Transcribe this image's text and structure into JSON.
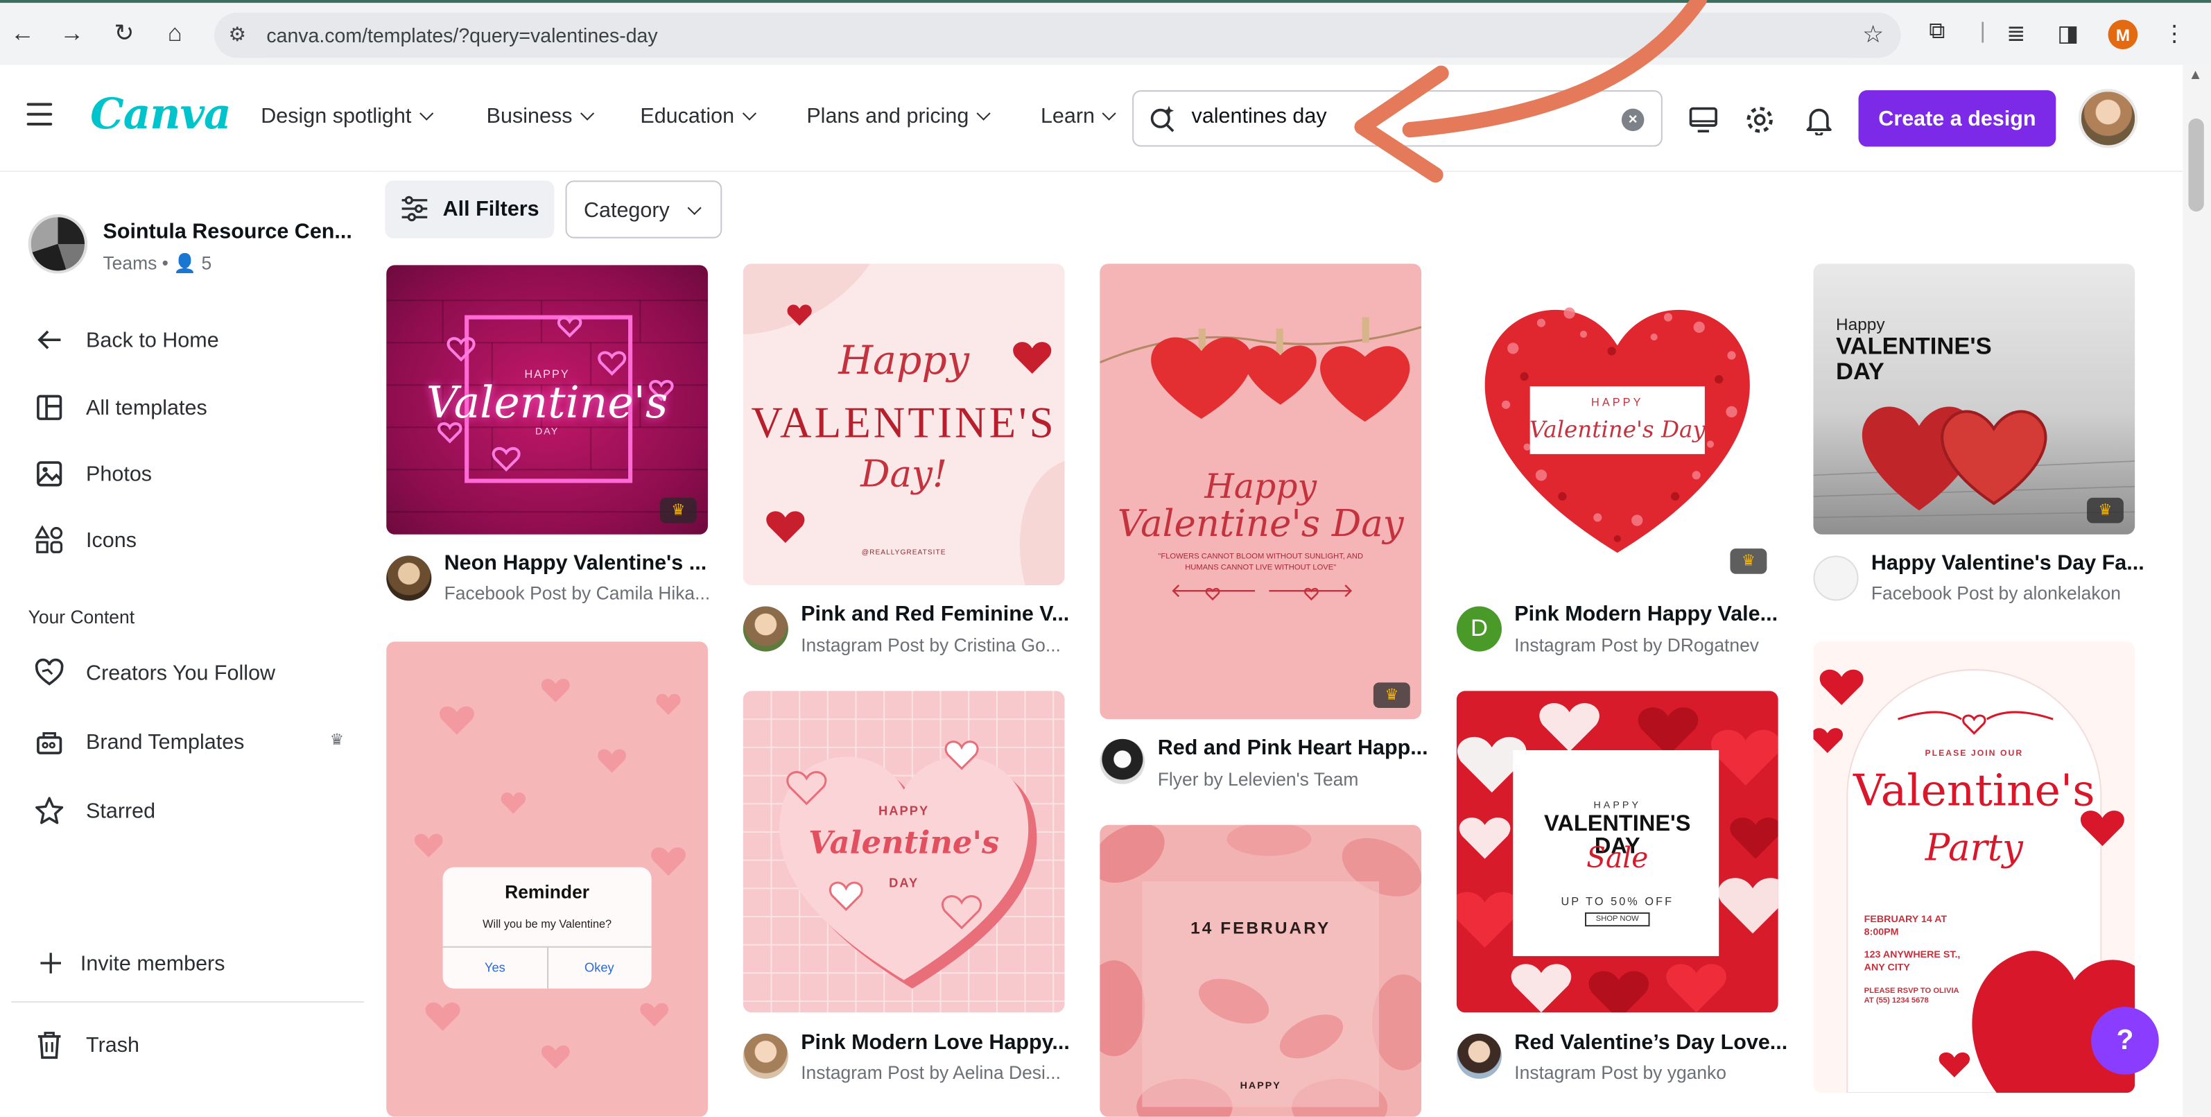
{
  "browser": {
    "url": "canva.com/templates/?query=valentines-day",
    "profile_initial": "M"
  },
  "header": {
    "logo": "Canva",
    "nav": [
      "Design spotlight",
      "Business",
      "Education",
      "Plans and pricing",
      "Learn"
    ],
    "search_value": "valentines day",
    "create_button": "Create a design"
  },
  "sidebar": {
    "team_name": "Sointula Resource Cen...",
    "team_sub": "Teams • 👤 5",
    "items": [
      "Back to Home",
      "All templates",
      "Photos",
      "Icons"
    ],
    "section_title": "Your Content",
    "content_items": [
      "Creators You Follow",
      "Brand Templates",
      "Starred"
    ],
    "invite": "Invite members",
    "trash": "Trash"
  },
  "filters": {
    "all_filters": "All Filters",
    "category": "Category"
  },
  "cards": [
    {
      "title": "Neon Happy Valentine's ...",
      "sub": "Facebook Post by Camila Hika..."
    },
    {
      "title": "Pink and Red Feminine V...",
      "sub": "Instagram Post by Cristina Go..."
    },
    {
      "title": "Red and Pink Heart Happ...",
      "sub": "Flyer by Lelevien's Team"
    },
    {
      "title": "Pink Modern Happy Vale...",
      "sub": "Instagram Post by DRogatnev",
      "avatar_letter": "D"
    },
    {
      "title": "Happy Valentine's Day Fa...",
      "sub": "Facebook Post by alonkelakon"
    },
    {
      "title": "Pink Modern Love Happy...",
      "sub": "Instagram Post by Aelina Desi..."
    },
    {
      "title": "Red Valentine’s Day Love...",
      "sub": "Instagram Post by yganko"
    }
  ],
  "thumbs": {
    "neon": {
      "happy": "HAPPY",
      "title": "Valentine's",
      "day": "DAY"
    },
    "pinkred": {
      "line1": "Happy",
      "line2": "VALENTINE'S",
      "line3": "Day!",
      "handle": "@REALLYGREATSITE"
    },
    "flyer": {
      "line1": "Happy",
      "line2": "Valentine's Day",
      "quote": "\"FLOWERS CANNOT BLOOM WITHOUT SUNLIGHT, AND HUMANS CANNOT LIVE WITHOUT LOVE\""
    },
    "heartmosaic": {
      "happy": "HAPPY",
      "title": "Valentine's Day"
    },
    "wood": {
      "line1": "Happy",
      "line2": "VALENTINE'S",
      "line3": "DAY"
    },
    "reminder": {
      "title": "Reminder",
      "question": "Will you be my Valentine?",
      "yes": "Yes",
      "okay": "Okey"
    },
    "grid": {
      "happy": "HAPPY",
      "title": "Valentine's",
      "day": "DAY"
    },
    "petals": {
      "date": "14 FEBRUARY",
      "bottom": "HAPPY"
    },
    "sale": {
      "happy": "HAPPY",
      "title": "VALENTINE'S DAY",
      "sale": "Sale",
      "offer": "UP TO 50% OFF",
      "shop": "SHOP NOW"
    },
    "party": {
      "join": "PLEASE JOIN OUR",
      "title": "Valentine's",
      "party": "Party",
      "date": "FEBRUARY 14 AT 8:00PM",
      "address": "123 ANYWHERE ST., ANY CITY",
      "rsvp": "PLEASE RSVP TO OLIVIA AT (55) 1234 5678"
    }
  },
  "help": "?"
}
